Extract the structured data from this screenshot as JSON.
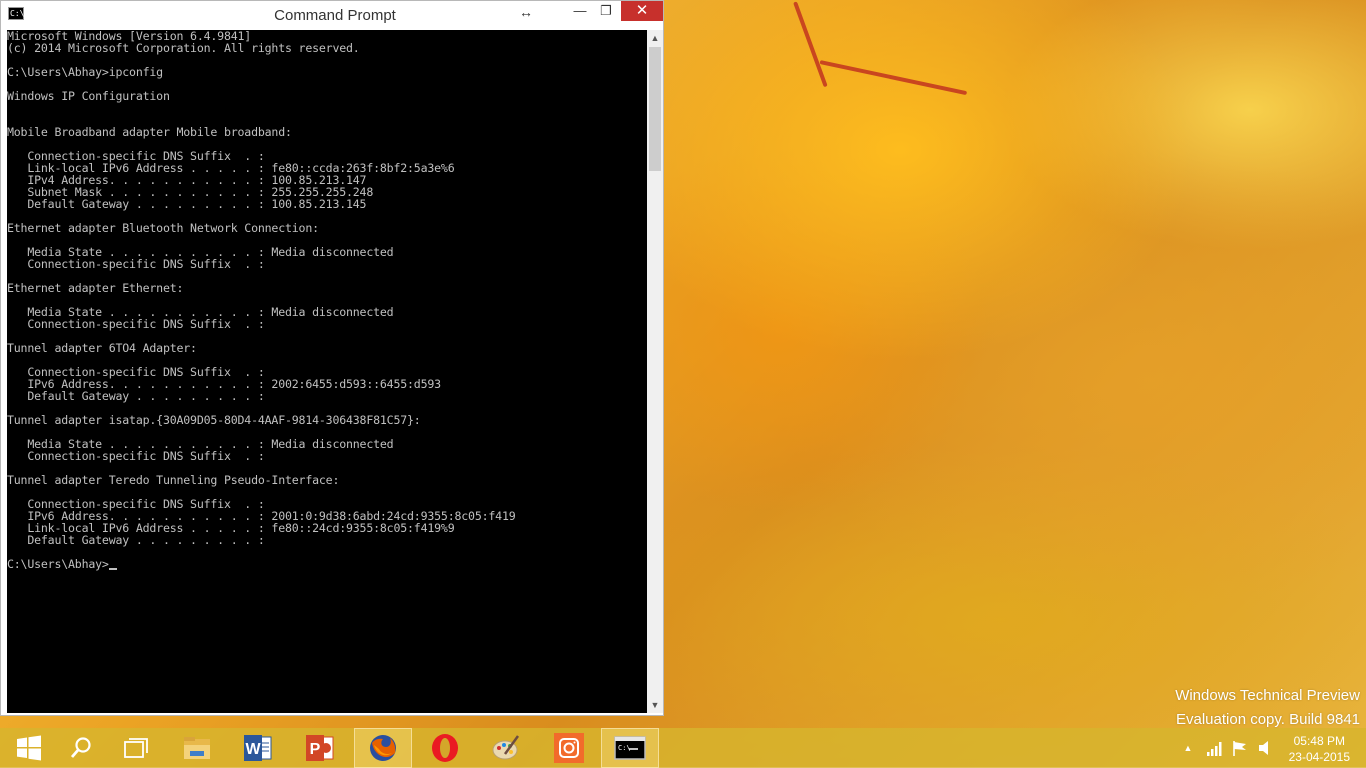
{
  "window": {
    "title": "Command Prompt",
    "resize_icon": "↔",
    "minimize_icon": "—",
    "maximize_icon": "❐",
    "close_icon": "✕"
  },
  "console": {
    "lines": [
      "Microsoft Windows [Version 6.4.9841]",
      "(c) 2014 Microsoft Corporation. All rights reserved.",
      "",
      "C:\\Users\\Abhay>ipconfig",
      "",
      "Windows IP Configuration",
      "",
      "",
      "Mobile Broadband adapter Mobile broadband:",
      "",
      "   Connection-specific DNS Suffix  . :",
      "   Link-local IPv6 Address . . . . . : fe80::ccda:263f:8bf2:5a3e%6",
      "   IPv4 Address. . . . . . . . . . . : 100.85.213.147",
      "   Subnet Mask . . . . . . . . . . . : 255.255.255.248",
      "   Default Gateway . . . . . . . . . : 100.85.213.145",
      "",
      "Ethernet adapter Bluetooth Network Connection:",
      "",
      "   Media State . . . . . . . . . . . : Media disconnected",
      "   Connection-specific DNS Suffix  . :",
      "",
      "Ethernet adapter Ethernet:",
      "",
      "   Media State . . . . . . . . . . . : Media disconnected",
      "   Connection-specific DNS Suffix  . :",
      "",
      "Tunnel adapter 6TO4 Adapter:",
      "",
      "   Connection-specific DNS Suffix  . :",
      "   IPv6 Address. . . . . . . . . . . : 2002:6455:d593::6455:d593",
      "   Default Gateway . . . . . . . . . :",
      "",
      "Tunnel adapter isatap.{30A09D05-80D4-4AAF-9814-306438F81C57}:",
      "",
      "   Media State . . . . . . . . . . . : Media disconnected",
      "   Connection-specific DNS Suffix  . :",
      "",
      "Tunnel adapter Teredo Tunneling Pseudo-Interface:",
      "",
      "   Connection-specific DNS Suffix  . :",
      "   IPv6 Address. . . . . . . . . . . : 2001:0:9d38:6abd:24cd:9355:8c05:f419",
      "   Link-local IPv6 Address . . . . . : fe80::24cd:9355:8c05:f419%9",
      "   Default Gateway . . . . . . . . . :",
      "",
      "C:\\Users\\Abhay>"
    ],
    "text_color": "#c0c0c0",
    "background": "#000000"
  },
  "desktop": {
    "watermark_line1": "Windows Technical Preview",
    "watermark_line2": "Evaluation copy. Build 9841"
  },
  "taskbar": {
    "items": [
      {
        "name": "start-button",
        "icon": "windows-logo-icon"
      },
      {
        "name": "search-button",
        "icon": "search-icon"
      },
      {
        "name": "task-view-button",
        "icon": "task-view-icon"
      },
      {
        "name": "file-explorer-button",
        "icon": "folder-icon"
      },
      {
        "name": "word-button",
        "icon": "word-icon",
        "letter": "W"
      },
      {
        "name": "powerpoint-button",
        "icon": "powerpoint-icon",
        "letter": "P"
      },
      {
        "name": "firefox-button",
        "icon": "firefox-icon"
      },
      {
        "name": "opera-button",
        "icon": "opera-icon"
      },
      {
        "name": "paint-button",
        "icon": "palette-icon"
      },
      {
        "name": "camera-app-button",
        "icon": "camera-icon"
      },
      {
        "name": "command-prompt-taskbar-button",
        "icon": "cmd-icon"
      }
    ],
    "clock_time": "05:48 PM",
    "clock_date": "23-04-2015",
    "accent": "#c7302c"
  }
}
